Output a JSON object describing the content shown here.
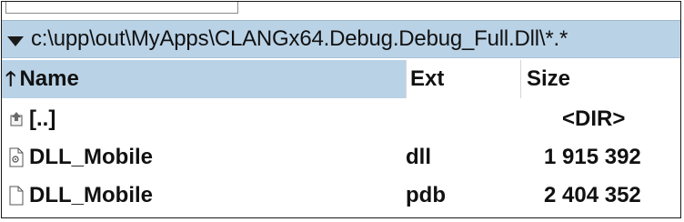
{
  "path": "c:\\upp\\out\\MyApps\\CLANGx64.Debug.Debug_Full.Dll\\*.*",
  "columns": {
    "name": "Name",
    "ext": "Ext",
    "size": "Size"
  },
  "rows": [
    {
      "name": "[..]",
      "ext": "",
      "size": "<DIR>",
      "icon": "folder-up-icon"
    },
    {
      "name": "DLL_Mobile",
      "ext": "dll",
      "size": "1 915 392",
      "icon": "dll-file-icon"
    },
    {
      "name": "DLL_Mobile",
      "ext": "pdb",
      "size": "2 404 352",
      "icon": "file-icon"
    }
  ],
  "colors": {
    "header_bg": "#b9d2e6",
    "path_bg": "#b9d2e6",
    "text": "#111111"
  }
}
